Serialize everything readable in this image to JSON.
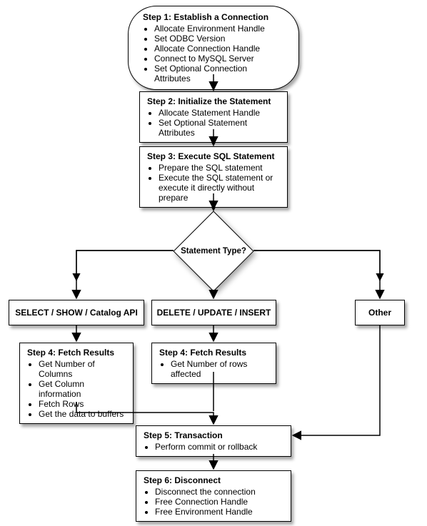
{
  "chart_data": {
    "type": "flowchart",
    "nodes": [
      {
        "id": "step1",
        "shape": "terminator",
        "title": "Step 1: Establish a Connection",
        "items": [
          "Allocate Environment Handle",
          "Set ODBC Version",
          "Allocate Connection Handle",
          "Connect to MySQL Server",
          "Set Optional Connection Attributes"
        ]
      },
      {
        "id": "step2",
        "shape": "process",
        "title": "Step 2: Initialize the Statement",
        "items": [
          "Allocate Statement Handle",
          "Set Optional Statement Attributes"
        ]
      },
      {
        "id": "step3",
        "shape": "process",
        "title": "Step 3: Execute SQL Statement",
        "items": [
          "Prepare the SQL statement",
          "Execute the SQL statement or execute it directly without prepare"
        ]
      },
      {
        "id": "decision",
        "shape": "decision",
        "title": "Statement Type?"
      },
      {
        "id": "branch_select",
        "shape": "process",
        "title": "SELECT / SHOW / Catalog API"
      },
      {
        "id": "branch_dml",
        "shape": "process",
        "title": "DELETE / UPDATE / INSERT"
      },
      {
        "id": "branch_other",
        "shape": "process",
        "title": "Other"
      },
      {
        "id": "step4a",
        "shape": "process",
        "title": "Step 4: Fetch Results",
        "items": [
          "Get Number of Columns",
          "Get Column information",
          "Fetch Rows",
          "Get the data to buffers"
        ]
      },
      {
        "id": "step4b",
        "shape": "process",
        "title": "Step 4: Fetch Results",
        "items": [
          "Get Number of rows affected"
        ]
      },
      {
        "id": "step5",
        "shape": "process",
        "title": "Step 5: Transaction",
        "items": [
          "Perform commit or rollback"
        ]
      },
      {
        "id": "step6",
        "shape": "process",
        "title": "Step 6: Disconnect",
        "items": [
          "Disconnect the connection",
          "Free Connection Handle",
          "Free Environment Handle"
        ]
      }
    ],
    "edges": [
      {
        "from": "step1",
        "to": "step2"
      },
      {
        "from": "step2",
        "to": "step3"
      },
      {
        "from": "step3",
        "to": "decision"
      },
      {
        "from": "decision",
        "to": "branch_select"
      },
      {
        "from": "decision",
        "to": "branch_dml"
      },
      {
        "from": "decision",
        "to": "branch_other"
      },
      {
        "from": "branch_select",
        "to": "step4a"
      },
      {
        "from": "branch_dml",
        "to": "step4b"
      },
      {
        "from": "step4a",
        "to": "step5"
      },
      {
        "from": "step4b",
        "to": "step5"
      },
      {
        "from": "branch_other",
        "to": "step5"
      },
      {
        "from": "step5",
        "to": "step6"
      }
    ]
  },
  "step1": {
    "title": "Step 1: Establish a Connection",
    "i0": "Allocate Environment Handle",
    "i1": "Set ODBC Version",
    "i2": "Allocate Connection Handle",
    "i3": "Connect to MySQL Server",
    "i4": "Set Optional Connection Attributes"
  },
  "step2": {
    "title": "Step 2: Initialize the Statement",
    "i0": "Allocate Statement Handle",
    "i1": "Set Optional Statement Attributes"
  },
  "step3": {
    "title": "Step 3: Execute SQL Statement",
    "i0": "Prepare the SQL statement",
    "i1": "Execute the SQL statement or execute it directly without prepare"
  },
  "decision": {
    "label": "Statement Type?"
  },
  "branch": {
    "select": "SELECT / SHOW / Catalog API",
    "dml": "DELETE / UPDATE / INSERT",
    "other": "Other"
  },
  "step4a": {
    "title": "Step 4: Fetch Results",
    "i0": "Get Number of Columns",
    "i1": "Get Column information",
    "i2": "Fetch Rows",
    "i3": "Get the data to buffers"
  },
  "step4b": {
    "title": "Step 4: Fetch Results",
    "i0": "Get Number of rows affected"
  },
  "step5": {
    "title": "Step 5: Transaction",
    "i0": "Perform commit or rollback"
  },
  "step6": {
    "title": "Step 6: Disconnect",
    "i0": "Disconnect the connection",
    "i1": "Free Connection Handle",
    "i2": "Free Environment Handle"
  }
}
